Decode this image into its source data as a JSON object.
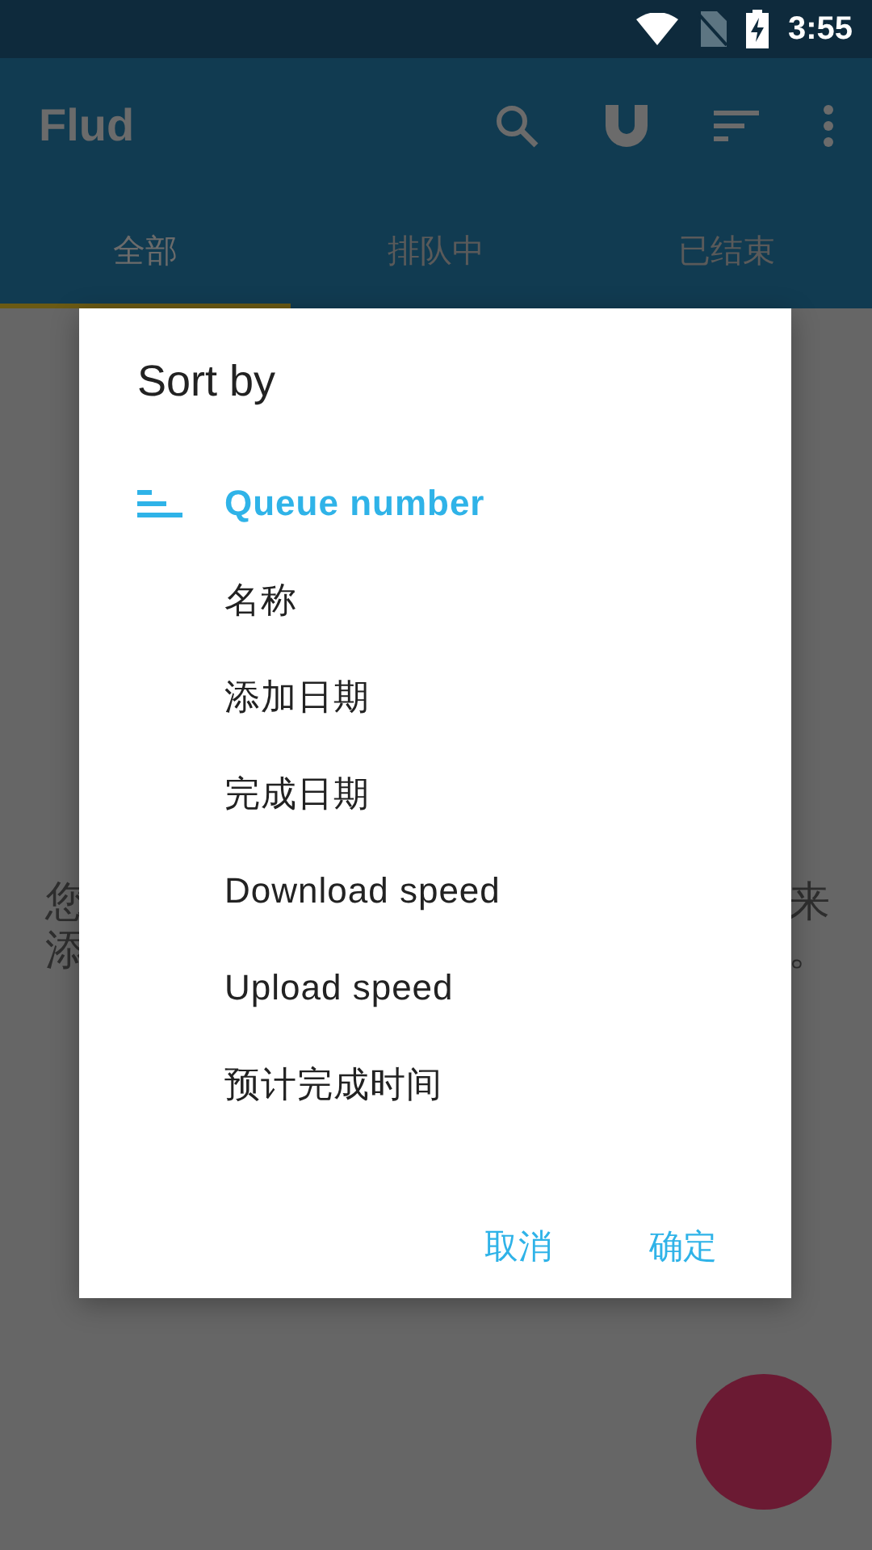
{
  "status_bar": {
    "time": "3:55"
  },
  "app_bar": {
    "title": "Flud"
  },
  "tabs": [
    {
      "label": "全部",
      "selected": true
    },
    {
      "label": "排队中",
      "selected": false
    },
    {
      "label": "已结束",
      "selected": false
    }
  ],
  "empty_message": {
    "left": [
      "您",
      "添"
    ],
    "right": [
      "来",
      "。"
    ]
  },
  "dialog": {
    "title": "Sort by",
    "options": [
      {
        "label": "Queue number",
        "selected": true
      },
      {
        "label": "名称",
        "selected": false
      },
      {
        "label": "添加日期",
        "selected": false
      },
      {
        "label": "完成日期",
        "selected": false
      },
      {
        "label": "Download speed",
        "selected": false
      },
      {
        "label": "Upload speed",
        "selected": false
      },
      {
        "label": "预计完成时间",
        "selected": false
      }
    ],
    "buttons": [
      "取消",
      "确定"
    ]
  }
}
